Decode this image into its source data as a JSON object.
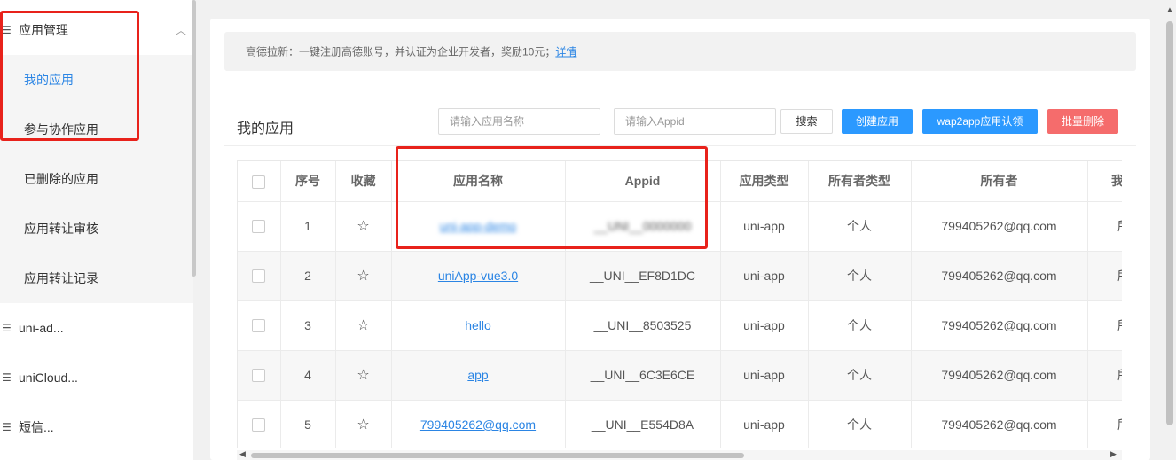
{
  "sidebar": {
    "app_manage": {
      "label": "应用管理"
    },
    "sub_items": [
      {
        "label": "我的应用"
      },
      {
        "label": "参与协作应用"
      },
      {
        "label": "已删除的应用"
      },
      {
        "label": "应用转让审核"
      },
      {
        "label": "应用转让记录"
      }
    ],
    "groups": [
      {
        "label": "uni-ad..."
      },
      {
        "label": "uniCloud..."
      },
      {
        "label": "短信..."
      }
    ]
  },
  "notice": {
    "text": "高德拉新：一键注册高德账号，并认证为企业开发者，奖励10元；",
    "link": "详情"
  },
  "page": {
    "title": "我的应用"
  },
  "toolbar": {
    "name_placeholder": "请输入应用名称",
    "appid_placeholder": "请输入Appid",
    "search_label": "搜索",
    "create_label": "创建应用",
    "wap2app_label": "wap2app应用认领",
    "batch_delete_label": "批量删除"
  },
  "table": {
    "headers": {
      "index": "序号",
      "favorite": "收藏",
      "name": "应用名称",
      "appid": "Appid",
      "type": "应用类型",
      "owner_type": "所有者类型",
      "owner": "所有者",
      "role": "我的"
    },
    "rows": [
      {
        "index": "1",
        "name": "uni-app-demo",
        "appid": "__UNI__0000000",
        "type": "uni-app",
        "owner_type": "个人",
        "owner": "799405262@qq.com",
        "role": "所"
      },
      {
        "index": "2",
        "name": "uniApp-vue3.0",
        "appid": "__UNI__EF8D1DC",
        "type": "uni-app",
        "owner_type": "个人",
        "owner": "799405262@qq.com",
        "role": "所"
      },
      {
        "index": "3",
        "name": "hello",
        "appid": "__UNI__8503525",
        "type": "uni-app",
        "owner_type": "个人",
        "owner": "799405262@qq.com",
        "role": "所"
      },
      {
        "index": "4",
        "name": "app",
        "appid": "__UNI__6C3E6CE",
        "type": "uni-app",
        "owner_type": "个人",
        "owner": "799405262@qq.com",
        "role": "所"
      },
      {
        "index": "5",
        "name": "799405262@qq.com",
        "appid": "__UNI__E554D8A",
        "type": "uni-app",
        "owner_type": "个人",
        "owner": "799405262@qq.com",
        "role": "所"
      }
    ]
  },
  "icons": {
    "list": "☰",
    "chevron_up": "︿",
    "star": "☆"
  },
  "colors": {
    "accent": "#2b85e4",
    "primary_button": "#2b99ff",
    "danger_button": "#f56c6c",
    "highlight_box": "#e8221b"
  }
}
